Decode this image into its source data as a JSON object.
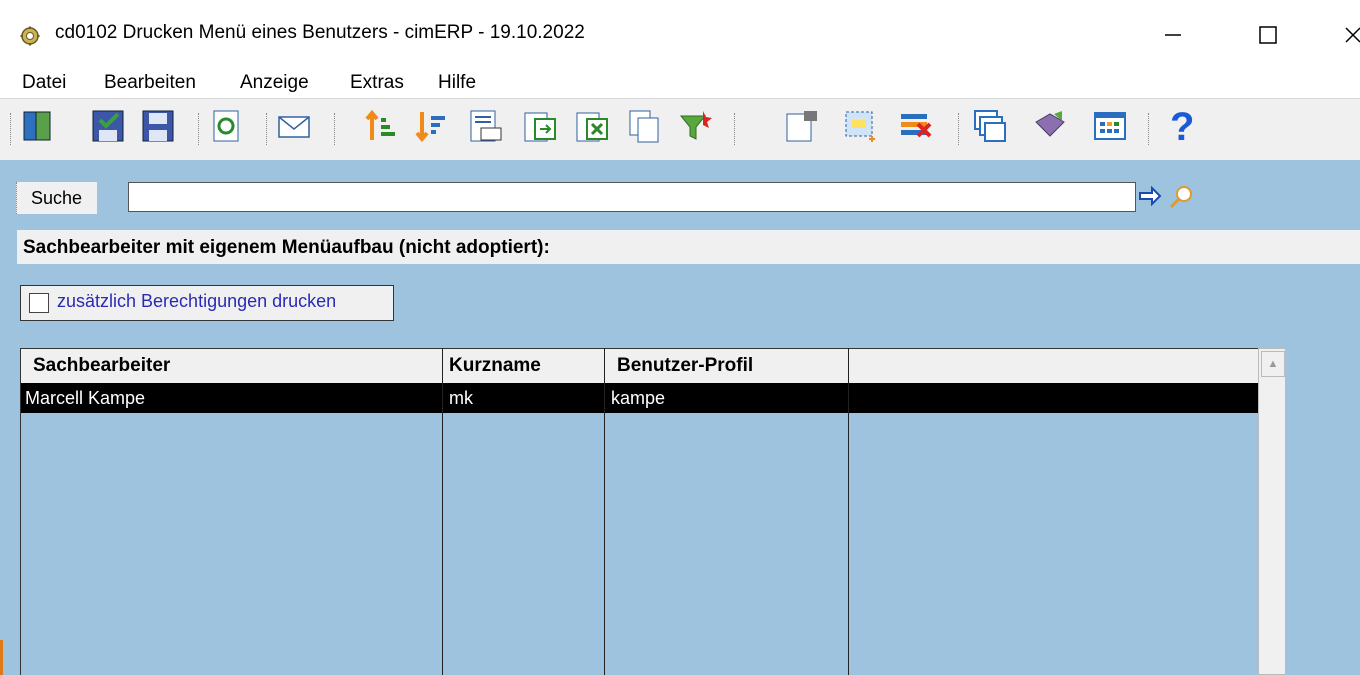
{
  "window": {
    "title": "cd0102 Drucken Menü eines Benutzers - cimERP - 19.10.2022",
    "app_icon": "gear-icon",
    "controls": [
      "minimize-icon",
      "maximize-icon",
      "close-icon"
    ]
  },
  "menu": {
    "items": [
      "Datei",
      "Bearbeiten",
      "Anzeige",
      "Extras",
      "Hilfe"
    ]
  },
  "toolbar": {
    "buttons": [
      "exit-door-icon",
      "save-check-icon",
      "save-icon",
      "refresh-icon",
      "mail-icon",
      "sort-ascending-icon",
      "sort-descending-icon",
      "number-format-icon",
      "export-icon",
      "excel-export-icon",
      "copy-icon",
      "filter-icon",
      "edit-icon",
      "select-area-icon",
      "delete-icon",
      "windows-icon",
      "book-icon",
      "grid-icon",
      "help-icon"
    ],
    "colors": {
      "help": "#1a5ad6",
      "accent_green": "#3aa23a",
      "accent_orange": "#f08a18"
    }
  },
  "search": {
    "label": "Suche",
    "value": "",
    "go_icon": "arrow-right-icon",
    "find_icon": "magnifier-icon"
  },
  "section": {
    "title": "Sachbearbeiter mit eigenem Menüaufbau (nicht adoptiert):"
  },
  "options": {
    "print_permissions_label": "zusätzlich Berechtigungen drucken",
    "print_permissions_checked": false
  },
  "table": {
    "columns": [
      "Sachbearbeiter",
      "Kurzname",
      "Benutzer-Profil",
      ""
    ],
    "rows": [
      {
        "sachbearbeiter": "Marcell Kampe",
        "kurzname": "mk",
        "profil": "kampe",
        "extra": "",
        "selected": true
      }
    ]
  },
  "colors": {
    "background": "#9dc3df",
    "panel": "#f0f0f0",
    "selection": "#000000",
    "checkbox_text": "#2a2ab5"
  }
}
